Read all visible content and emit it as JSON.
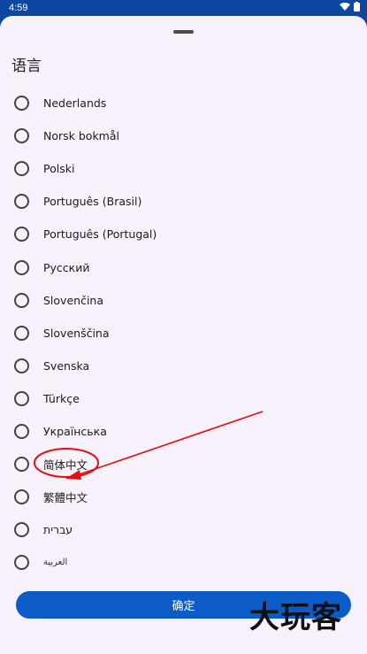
{
  "status_bar": {
    "time": "4:59"
  },
  "dialog": {
    "title": "语言",
    "options": [
      {
        "label": "Nederlands"
      },
      {
        "label": "Norsk bokmål"
      },
      {
        "label": "Polski"
      },
      {
        "label": "Português (Brasil)"
      },
      {
        "label": "Português (Portugal)"
      },
      {
        "label": "Русский"
      },
      {
        "label": "Slovenčina"
      },
      {
        "label": "Slovenščina"
      },
      {
        "label": "Svenska"
      },
      {
        "label": "Türkçe"
      },
      {
        "label": "Українська"
      },
      {
        "label": "简体中文"
      },
      {
        "label": "繁體中文"
      },
      {
        "label": "עברית"
      },
      {
        "label": "العربية"
      }
    ],
    "confirm_label": "确定"
  },
  "watermark": "大玩客",
  "colors": {
    "accent": "#0d5bc6",
    "sheet_bg": "#f6f1fb",
    "annotation": "#e01010"
  }
}
